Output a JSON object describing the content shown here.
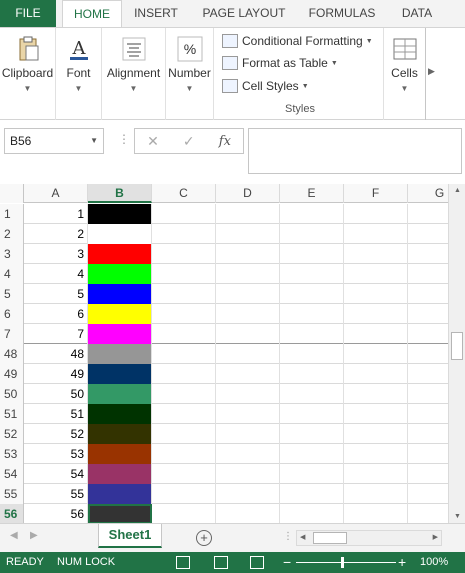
{
  "ribbon_tabs": [
    {
      "label": "FILE"
    },
    {
      "label": "HOME",
      "active": true
    },
    {
      "label": "INSERT"
    },
    {
      "label": "PAGE LAYOUT"
    },
    {
      "label": "FORMULAS"
    },
    {
      "label": "DATA"
    }
  ],
  "ribbon": {
    "clipboard": {
      "label": "Clipboard",
      "icon": "clipboard-icon"
    },
    "font": {
      "label": "Font",
      "icon": "font-icon"
    },
    "alignment": {
      "label": "Alignment",
      "icon": "alignment-icon"
    },
    "number": {
      "label": "Number",
      "icon": "percent-icon",
      "glyph": "%"
    },
    "styles": {
      "conditional": "Conditional Formatting",
      "table": "Format as Table",
      "cellstyles": "Cell Styles",
      "group_label": "Styles"
    },
    "cells": {
      "label": "Cells",
      "icon": "cells-icon"
    },
    "font_glyph": "A"
  },
  "formula_bar": {
    "name_box": "B56",
    "cancel_glyph": "✕",
    "enter_glyph": "✓",
    "fx_glyph": "fx",
    "formula": ""
  },
  "grid": {
    "columns": [
      "A",
      "B",
      "C",
      "D",
      "E",
      "F",
      "G"
    ],
    "selected_column": "B",
    "rows": [
      {
        "row": "1",
        "a": "1",
        "color": "#000000"
      },
      {
        "row": "2",
        "a": "2",
        "color": "#FFFFFF"
      },
      {
        "row": "3",
        "a": "3",
        "color": "#FF0000"
      },
      {
        "row": "4",
        "a": "4",
        "color": "#00FF00"
      },
      {
        "row": "5",
        "a": "5",
        "color": "#0000FF"
      },
      {
        "row": "6",
        "a": "6",
        "color": "#FFFF00"
      },
      {
        "row": "7",
        "a": "7",
        "color": "#FF00FF"
      },
      {
        "row": "48",
        "a": "48",
        "color": "#969696"
      },
      {
        "row": "49",
        "a": "49",
        "color": "#003366"
      },
      {
        "row": "50",
        "a": "50",
        "color": "#339966"
      },
      {
        "row": "51",
        "a": "51",
        "color": "#003300"
      },
      {
        "row": "52",
        "a": "52",
        "color": "#333300"
      },
      {
        "row": "53",
        "a": "53",
        "color": "#993300"
      },
      {
        "row": "54",
        "a": "54",
        "color": "#993366"
      },
      {
        "row": "55",
        "a": "55",
        "color": "#333399"
      },
      {
        "row": "56",
        "a": "56",
        "color": "#333333",
        "selected": true
      }
    ]
  },
  "sheets": {
    "active": "Sheet1",
    "add_glyph": "+"
  },
  "statusbar": {
    "ready": "READY",
    "numlock": "NUM LOCK",
    "zoom": "100%",
    "minus": "−",
    "plus": "+"
  },
  "colors": {
    "accent": "#217346"
  }
}
